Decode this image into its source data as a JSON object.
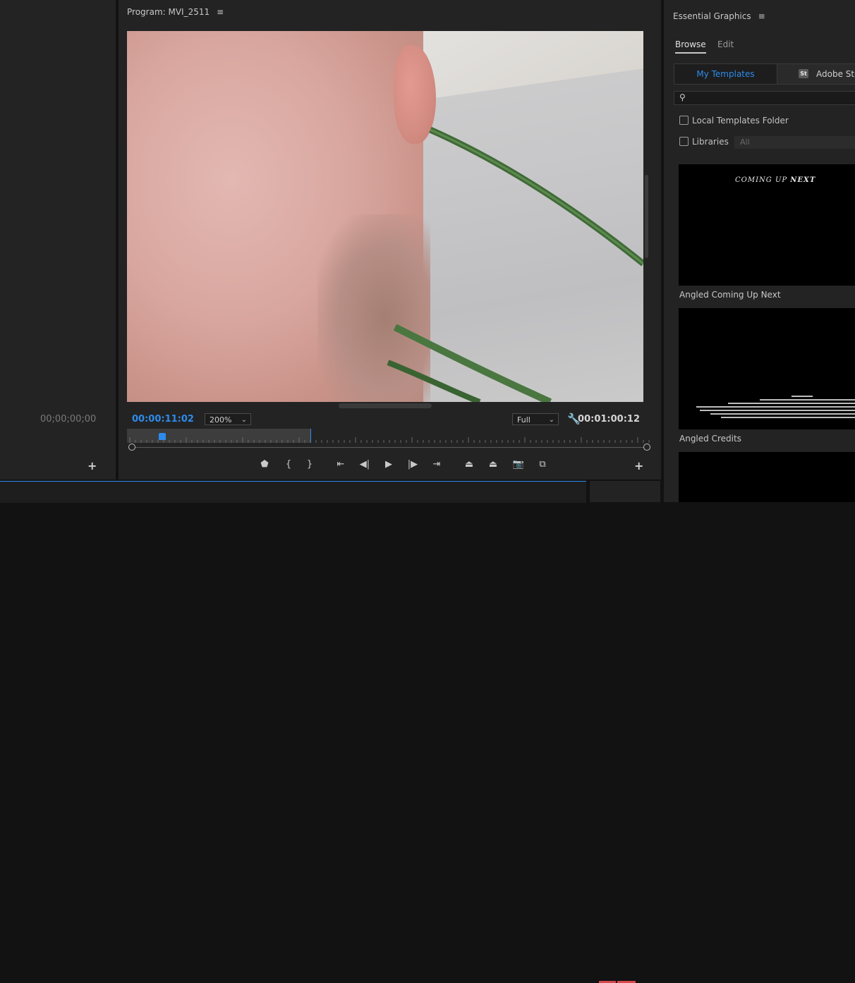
{
  "left_panel": {
    "timecode": "00;00;00;00"
  },
  "program": {
    "title": "Program: MVI_2511",
    "menu_icon": "hamburger-icon",
    "current_time": "00:00:11:02",
    "zoom_value": "200%",
    "resolution_value": "Full",
    "duration": "00:01:00:12",
    "playhead_fraction": 0.06,
    "transport": [
      {
        "name": "add-marker-button",
        "glyph": "⬟"
      },
      {
        "name": "mark-in-button",
        "glyph": "{"
      },
      {
        "name": "mark-out-button",
        "glyph": "}"
      },
      {
        "name": "go-to-in-button",
        "glyph": "⇤"
      },
      {
        "name": "step-back-button",
        "glyph": "◀|"
      },
      {
        "name": "play-button",
        "glyph": "▶"
      },
      {
        "name": "step-forward-button",
        "glyph": "|▶"
      },
      {
        "name": "go-to-out-button",
        "glyph": "⇥"
      },
      {
        "name": "lift-button",
        "glyph": "⏏"
      },
      {
        "name": "extract-button",
        "glyph": "⏏"
      },
      {
        "name": "export-frame-button",
        "glyph": "📷"
      },
      {
        "name": "compare-view-button",
        "glyph": "⧉"
      }
    ]
  },
  "essential_graphics": {
    "title": "Essential Graphics",
    "tabs": [
      {
        "label": "Browse",
        "active": true
      },
      {
        "label": "Edit",
        "active": false
      }
    ],
    "segment_my_templates": "My Templates",
    "segment_stock": "Adobe Stoc",
    "stock_badge": "St",
    "filters": [
      {
        "label": "Local Templates Folder"
      },
      {
        "label": "Libraries"
      }
    ],
    "libraries_select": "All",
    "templates": [
      {
        "name": "Angled Coming Up Next",
        "preview_text_a": "COMING UP ",
        "preview_text_b": "NEXT"
      },
      {
        "name": "Angled Credits"
      }
    ]
  }
}
